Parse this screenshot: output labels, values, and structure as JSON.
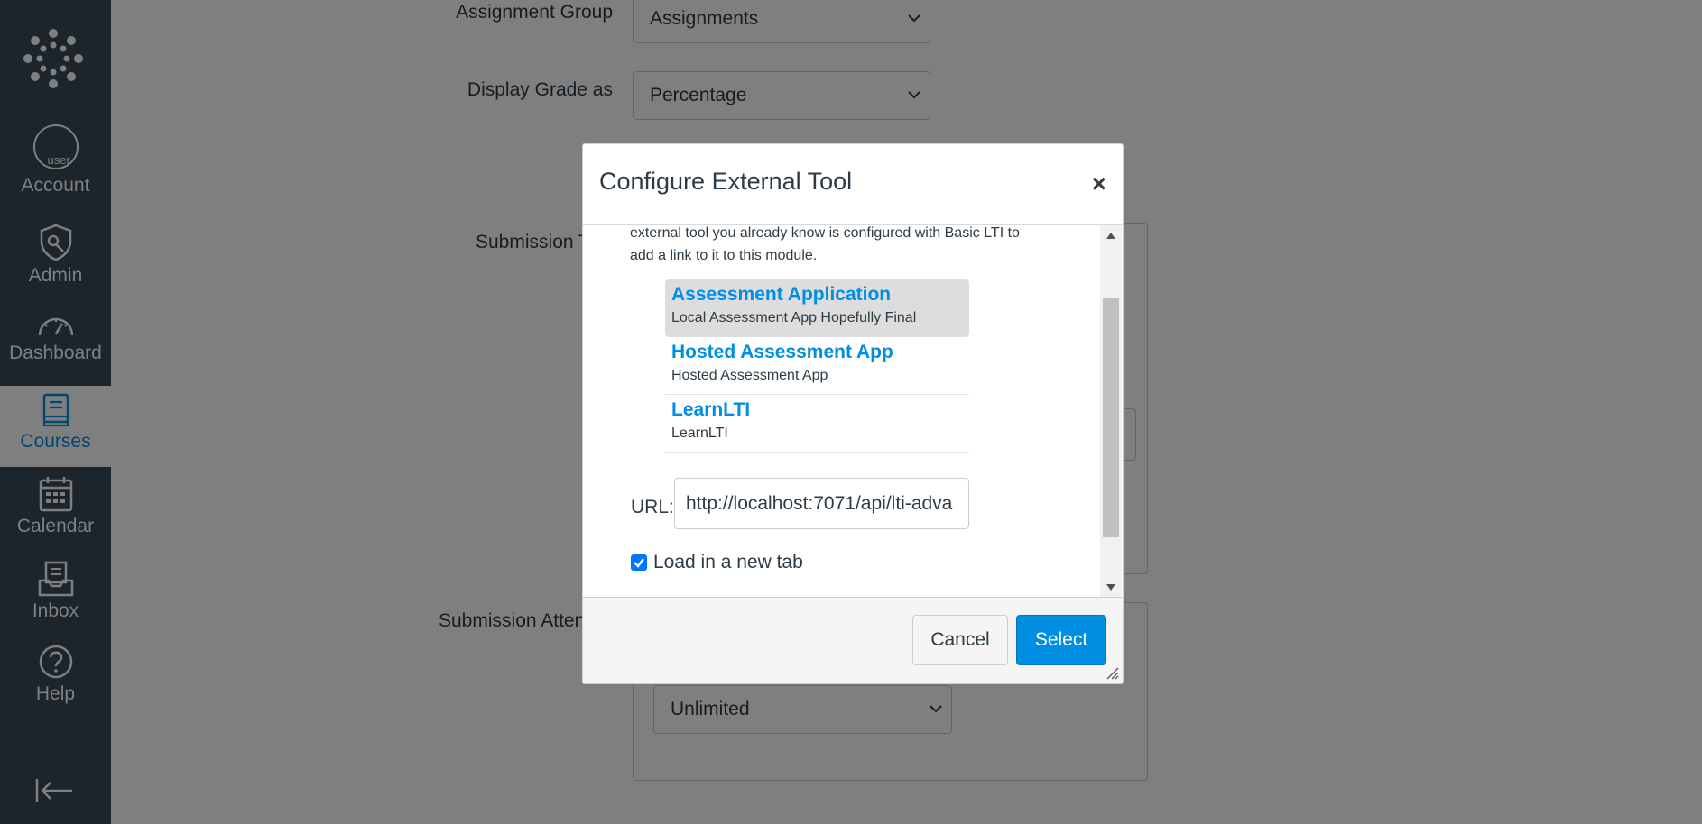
{
  "nav": {
    "items": [
      {
        "id": "account",
        "label": "Account"
      },
      {
        "id": "admin",
        "label": "Admin"
      },
      {
        "id": "dashboard",
        "label": "Dashboard"
      },
      {
        "id": "courses",
        "label": "Courses"
      },
      {
        "id": "calendar",
        "label": "Calendar"
      },
      {
        "id": "inbox",
        "label": "Inbox"
      },
      {
        "id": "help",
        "label": "Help"
      }
    ],
    "active": "courses",
    "avatar_alt": "user"
  },
  "form": {
    "assignment_group_label": "Assignment Group",
    "assignment_group_value": "Assignments",
    "display_grade_label": "Display Grade as",
    "display_grade_value": "Percentage",
    "submission_type_label": "Submission T",
    "submission_attempts_label": "Submission Atten",
    "allowed_attempts_value": "Unlimited"
  },
  "dialog": {
    "title": "Configure External Tool",
    "close_symbol": "×",
    "intro_text": "external tool you already know is configured with Basic LTI to add a link to it to this module.",
    "tools": [
      {
        "name": "Assessment Application",
        "description": "Local Assessment App Hopefully Final",
        "selected": true
      },
      {
        "name": "Hosted Assessment App",
        "description": "Hosted Assessment App",
        "selected": false
      },
      {
        "name": "LearnLTI",
        "description": "LearnLTI",
        "selected": false
      }
    ],
    "url_label": "URL:",
    "url_value": "http://localhost:7071/api/lti-adva",
    "new_tab_label": "Load in a new tab",
    "new_tab_checked": true,
    "cancel_label": "Cancel",
    "select_label": "Select"
  },
  "colors": {
    "nav_bg": "#394B58",
    "brand_blue": "#008EE2",
    "text": "#2D3B45",
    "overlay": "rgba(0,0,0,0.5)"
  }
}
